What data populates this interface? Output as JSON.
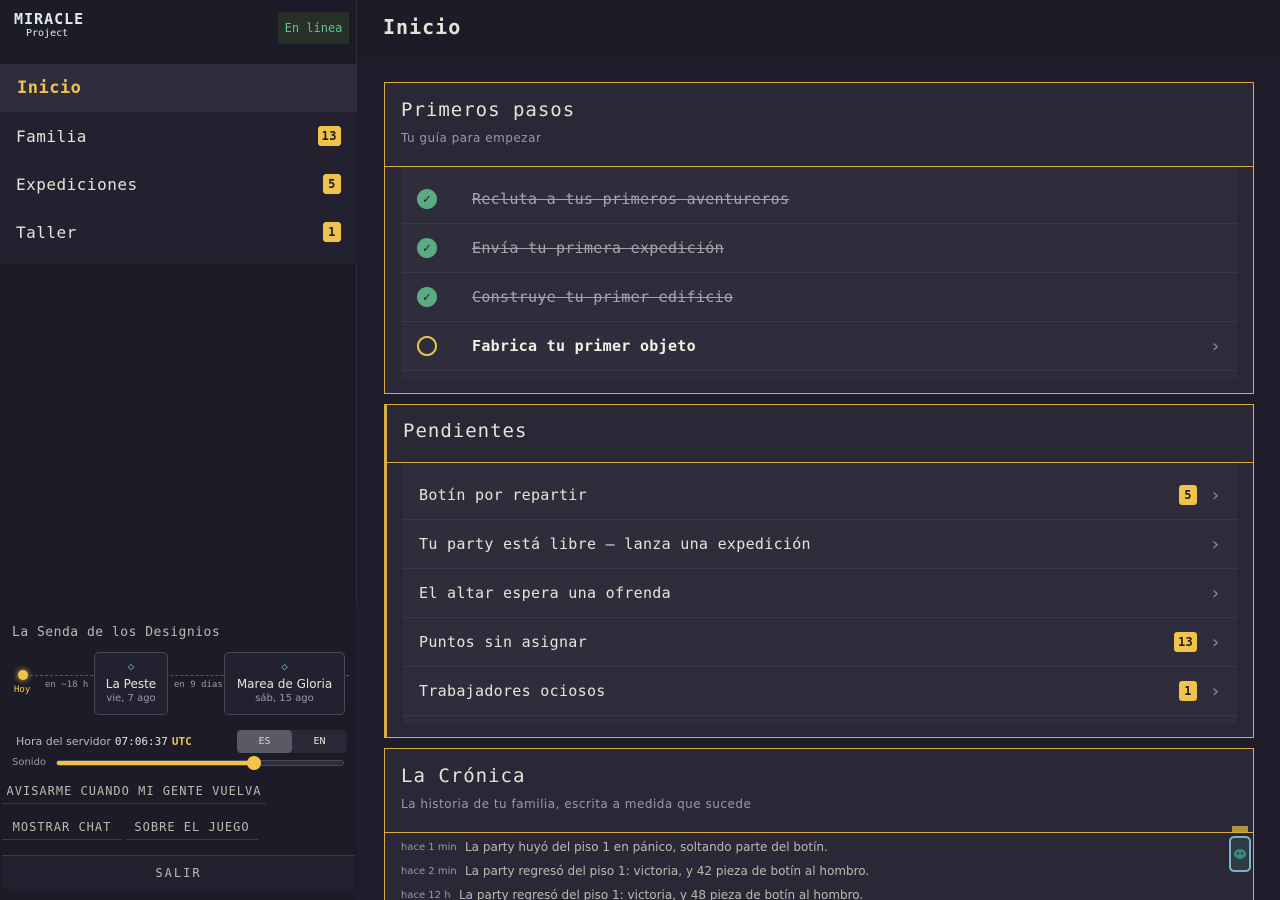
{
  "brand": {
    "line1": "MIRACLE",
    "line2": "Project"
  },
  "status": "En línea",
  "nav": [
    {
      "label": "Inicio",
      "badge": null,
      "active": true
    },
    {
      "label": "Familia",
      "badge": "13"
    },
    {
      "label": "Expediciones",
      "badge": "5"
    },
    {
      "label": "Taller",
      "badge": "1"
    }
  ],
  "senda": {
    "title": "La Senda de los Designios",
    "today": "Hoy",
    "gap1": "en ~18 h",
    "gap2": "en 9 días",
    "events": [
      {
        "name": "La Peste",
        "date": "vie, 7 ago"
      },
      {
        "name": "Marea de Gloria",
        "date": "sáb, 15 ago"
      }
    ]
  },
  "server": {
    "label": "Hora del servidor",
    "time": "07:06:37",
    "tz": "UTC"
  },
  "lang": {
    "es": "ES",
    "en": "EN",
    "selected": "ES"
  },
  "sound": {
    "label": "Sonido",
    "level": 0.69
  },
  "buttons": {
    "notify": "AVISARME CUANDO MI GENTE VUELVA",
    "chat": "MOSTRAR CHAT",
    "about": "SOBRE EL JUEGO",
    "logout": "SALIR"
  },
  "page": {
    "title": "Inicio"
  },
  "primeros": {
    "title": "Primeros pasos",
    "subtitle": "Tu guía para empezar",
    "items": [
      {
        "label": "Recluta a tus primeros aventureros",
        "done": true
      },
      {
        "label": "Envía tu primera expedición",
        "done": true
      },
      {
        "label": "Construye tu primer edificio",
        "done": true
      },
      {
        "label": "Fabrica tu primer objeto",
        "done": false
      }
    ]
  },
  "pendientes": {
    "title": "Pendientes",
    "items": [
      {
        "label": "Botín por repartir",
        "badge": "5"
      },
      {
        "label": "Tu party está libre — lanza una expedición",
        "badge": null
      },
      {
        "label": "El altar espera una ofrenda",
        "badge": null
      },
      {
        "label": "Puntos sin asignar",
        "badge": "13"
      },
      {
        "label": "Trabajadores ociosos",
        "badge": "1"
      }
    ]
  },
  "cronica": {
    "title": "La Crónica",
    "subtitle": "La historia de tu familia, escrita a medida que sucede",
    "entries": [
      {
        "ago": "hace 1 min",
        "text": "La party huyó del piso 1 en pánico, soltando parte del botín."
      },
      {
        "ago": "hace 2 min",
        "text": "La party regresó del piso 1: victoria, y 42 pieza de botín al hombro."
      },
      {
        "ago": "hace 12 h",
        "text": "La party regresó del piso 1: victoria, y 48 pieza de botín al hombro."
      }
    ]
  },
  "colors": {
    "accent": "#f0c34a",
    "success": "#5aab83",
    "bg": "#1f1d2b"
  }
}
